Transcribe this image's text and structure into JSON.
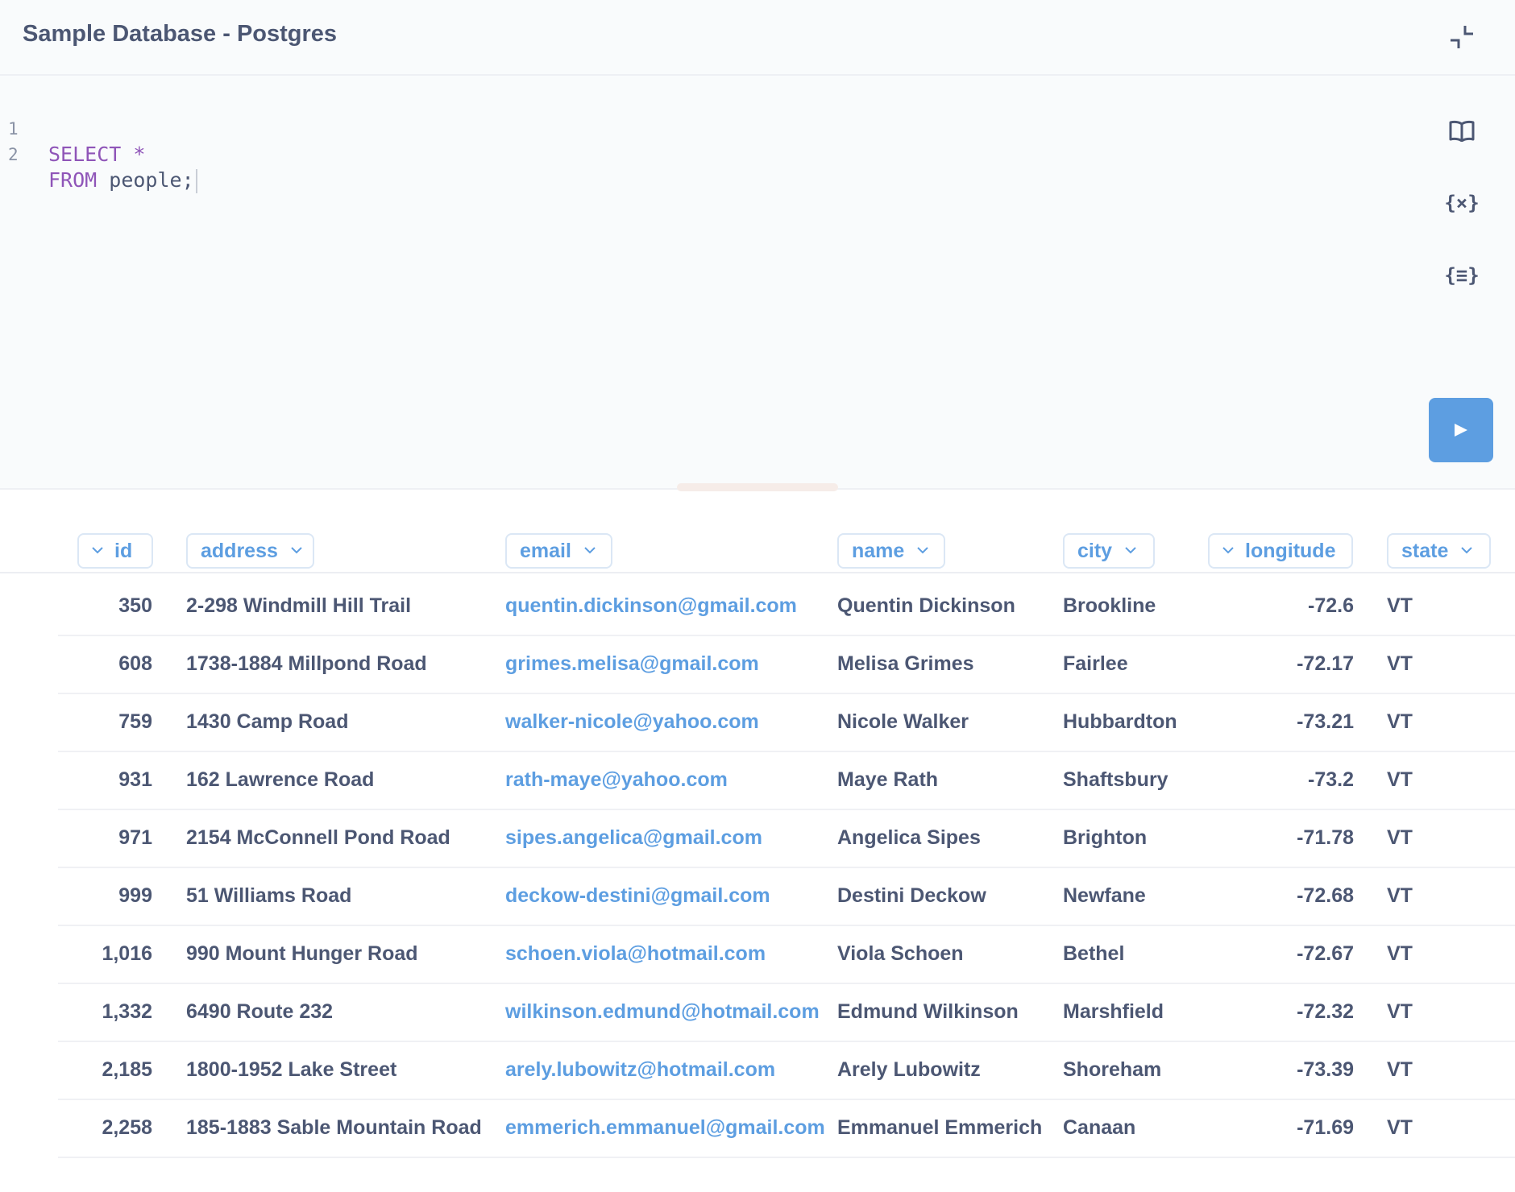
{
  "header": {
    "title": "Sample Database - Postgres",
    "collapse_icon": "collapse-icon"
  },
  "editor": {
    "lines": [
      {
        "number": "1",
        "keyword": "SELECT",
        "rest": " *"
      },
      {
        "number": "2",
        "keyword": "FROM",
        "rest": " people;"
      }
    ],
    "side_icons": [
      "book-icon",
      "variables-icon",
      "snippets-icon"
    ],
    "variables_glyph": "{×}",
    "snippets_glyph": "{≡}",
    "run_icon": "play-icon",
    "accent_color": "#5d9ee1"
  },
  "results": {
    "columns": [
      "id",
      "address",
      "email",
      "name",
      "city",
      "longitude",
      "state"
    ],
    "rows": [
      [
        "350",
        "2-298 Windmill Hill Trail",
        "quentin.dickinson@gmail.com",
        "Quentin Dickinson",
        "Brookline",
        "-72.6",
        "VT"
      ],
      [
        "608",
        "1738-1884 Millpond Road",
        "grimes.melisa@gmail.com",
        "Melisa Grimes",
        "Fairlee",
        "-72.17",
        "VT"
      ],
      [
        "759",
        "1430 Camp Road",
        "walker-nicole@yahoo.com",
        "Nicole Walker",
        "Hubbardton",
        "-73.21",
        "VT"
      ],
      [
        "931",
        "162 Lawrence Road",
        "rath-maye@yahoo.com",
        "Maye Rath",
        "Shaftsbury",
        "-73.2",
        "VT"
      ],
      [
        "971",
        "2154 McConnell Pond Road",
        "sipes.angelica@gmail.com",
        "Angelica Sipes",
        "Brighton",
        "-71.78",
        "VT"
      ],
      [
        "999",
        "51 Williams Road",
        "deckow-destini@gmail.com",
        "Destini Deckow",
        "Newfane",
        "-72.68",
        "VT"
      ],
      [
        "1,016",
        "990 Mount Hunger Road",
        "schoen.viola@hotmail.com",
        "Viola Schoen",
        "Bethel",
        "-72.67",
        "VT"
      ],
      [
        "1,332",
        "6490 Route 232",
        "wilkinson.edmund@hotmail.com",
        "Edmund Wilkinson",
        "Marshfield",
        "-72.32",
        "VT"
      ],
      [
        "2,185",
        "1800-1952 Lake Street",
        "arely.lubowitz@hotmail.com",
        "Arely Lubowitz",
        "Shoreham",
        "-73.39",
        "VT"
      ],
      [
        "2,258",
        "185-1883 Sable Mountain Road",
        "emmerich.emmanuel@gmail.com",
        "Emmanuel Emmerich",
        "Canaan",
        "-71.69",
        "VT"
      ]
    ]
  }
}
